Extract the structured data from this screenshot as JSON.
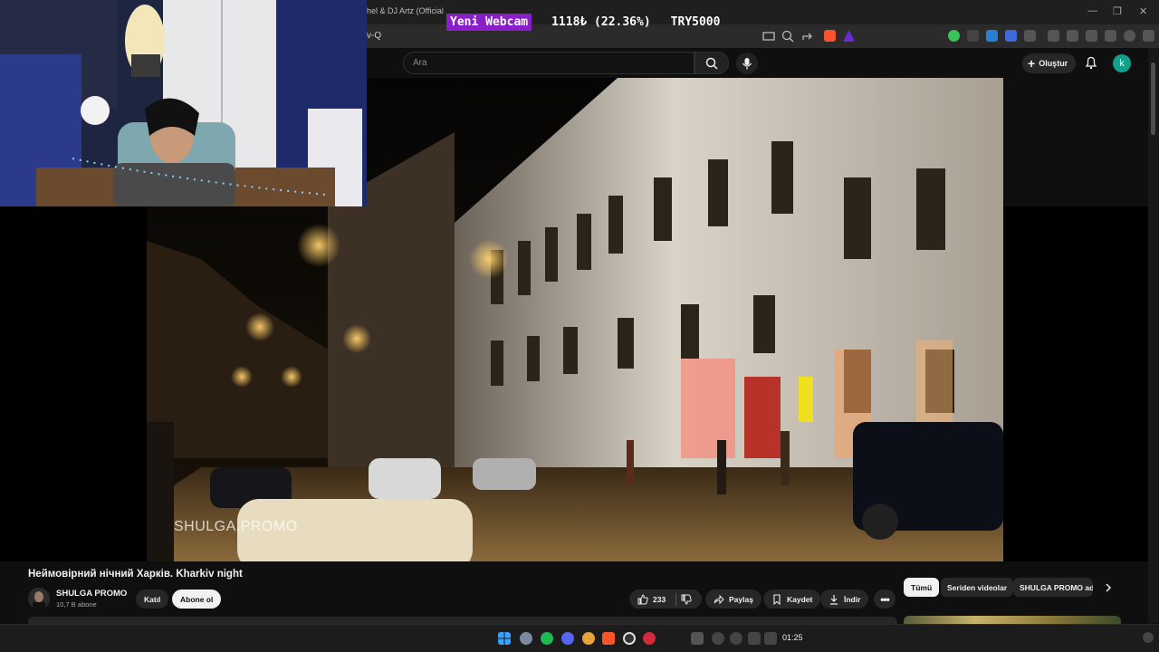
{
  "browser": {
    "tab_title": "hel & DJ Artz (Official",
    "url_fragment": "v-Q",
    "window_controls": [
      "—",
      "❐",
      "✕"
    ]
  },
  "overlay": {
    "label": "Yeni Webcam",
    "count": "1118₺ (22.36%)",
    "goal": "TRY5000"
  },
  "youtube": {
    "search": {
      "placeholder": "Ara"
    },
    "create_label": "Oluştur",
    "account_initial": "k",
    "colors": {
      "accent": "#8a1ec9",
      "avatar": "#12a08a"
    }
  },
  "video": {
    "watermark": "SHULGA.PROMO",
    "title": "Неймовірний нічний Харків. Kharkiv night",
    "channel": {
      "name": "SHULGA PROMO",
      "subscribers": "10,7 B abone"
    },
    "join_label": "Katıl",
    "subscribe_label": "Abone ol",
    "likes": "233",
    "share_label": "Paylaş",
    "save_label": "Kaydet",
    "download_label": "İndir",
    "more_icon": "more-icon"
  },
  "chips": [
    "Tümü",
    "Seriden videolar",
    "SHULGA PROMO adlı"
  ],
  "taskbar": {
    "time": "01:25"
  }
}
